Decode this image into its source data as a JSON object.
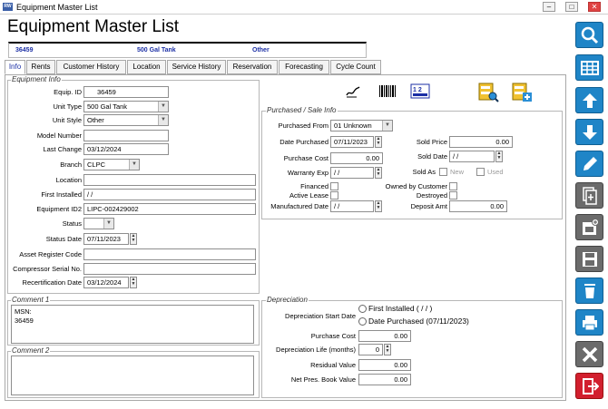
{
  "window": {
    "title": "Equipment Master List",
    "min": "–",
    "max": "□",
    "close": "✕"
  },
  "page": {
    "title": "Equipment Master List"
  },
  "infobar": {
    "id": "36459",
    "desc": "500 Gal Tank",
    "type": "Other"
  },
  "tabs": [
    {
      "label": "Info"
    },
    {
      "label": "Rents"
    },
    {
      "label": "Customer History"
    },
    {
      "label": "Location"
    },
    {
      "label": "Service History"
    },
    {
      "label": "Reservation"
    },
    {
      "label": "Forecasting"
    },
    {
      "label": "Cycle Count"
    }
  ],
  "equipment_info": {
    "legend": "Equipment Info",
    "equip_id_label": "Equip. ID",
    "equip_id": "36459",
    "unit_type_label": "Unit Type",
    "unit_type": "500 Gal Tank",
    "unit_style_label": "Unit Style",
    "unit_style": "Other",
    "model_label": "Model Number",
    "model": "",
    "last_change_label": "Last Change",
    "last_change": "03/12/2024",
    "branch_label": "Branch",
    "branch": "CLPC",
    "location_label": "Location",
    "location": "",
    "first_installed_label": "First Installed",
    "first_installed": " / /",
    "equip_id2_label": "Equipment ID2",
    "equip_id2": "LIPC-002429002",
    "status_label": "Status",
    "status": "",
    "status_date_label": "Status Date",
    "status_date": "07/11/2023",
    "asset_label": "Asset Register Code",
    "asset": "",
    "compressor_label": "Compressor Serial No.",
    "compressor": "",
    "recert_label": "Recertification Date",
    "recert": "03/12/2024"
  },
  "comments": {
    "c1_legend": "Comment 1",
    "c1_line1": "MSN:",
    "c1_line2": "36459",
    "c2_legend": "Comment 2"
  },
  "purchase": {
    "legend": "Purchased / Sale Info",
    "from_label": "Purchased From",
    "from": "01 Unknown",
    "date_label": "Date Purchased",
    "date": "07/11/2023",
    "cost_label": "Purchase Cost",
    "cost": "0.00",
    "warranty_label": "Warranty Exp",
    "warranty": " / /",
    "financed_label": "Financed",
    "active_lease_label": "Active Lease",
    "mfg_label": "Manufactured Date",
    "mfg": " / /",
    "sold_price_label": "Sold Price",
    "sold_price": "0.00",
    "sold_date_label": "Sold Date",
    "sold_date": " / /",
    "sold_as_label": "Sold As",
    "new_label": "New",
    "used_label": "Used",
    "owned_label": "Owned by Customer",
    "destroyed_label": "Destroyed",
    "deposit_label": "Deposit Amt",
    "deposit": "0.00"
  },
  "depreciation": {
    "legend": "Depreciation",
    "start_label": "Depreciation Start Date",
    "opt1": "First Installed (  /  /  )",
    "opt2": "Date Purchased (07/11/2023)",
    "cost_label": "Purchase Cost",
    "cost": "0.00",
    "life_label": "Depreciation Life (months)",
    "life": "0",
    "residual_label": "Residual Value",
    "residual": "0.00",
    "npbv_label": "Net Pres. Book Value",
    "npbv": "0.00"
  },
  "toolbar_icons": [
    "signature-icon",
    "barcode-icon",
    "numbers-icon",
    "search-folder-icon",
    "new-folder-icon"
  ],
  "sidebar": [
    "search-icon",
    "grid-icon",
    "arrow-up-icon",
    "arrow-down-icon",
    "edit-icon",
    "copy-icon",
    "add-card-icon",
    "save-icon",
    "delete-icon",
    "print-icon",
    "close-icon",
    "exit-icon"
  ],
  "colors": {
    "accent": "#1f85c7",
    "link": "#1b2fa5",
    "danger": "#d21f2e"
  }
}
